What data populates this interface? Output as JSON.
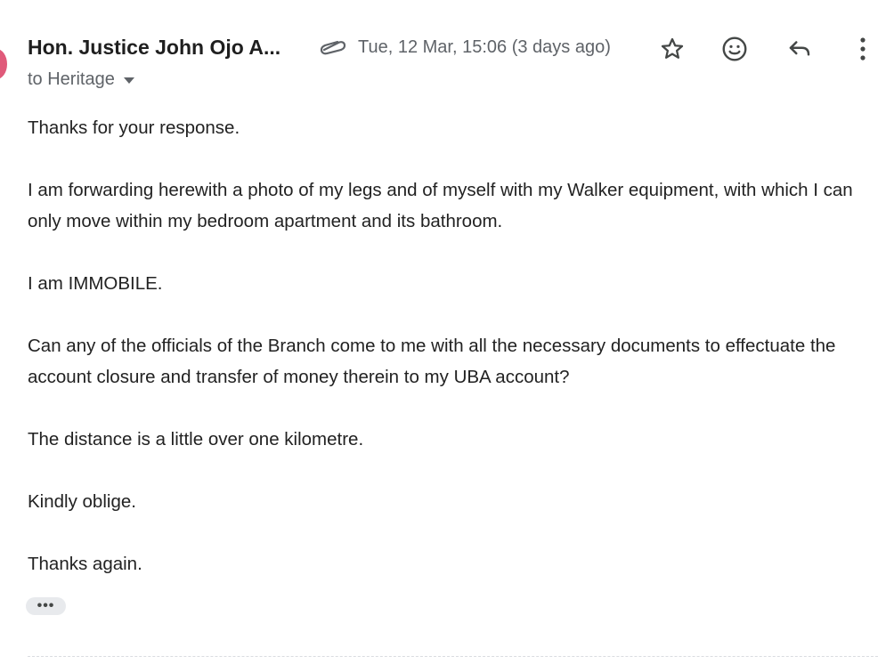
{
  "header": {
    "sender": "Hon. Justice John Ojo A...",
    "timestamp": "Tue, 12 Mar, 15:06 (3 days ago)",
    "attachment_icon": "paperclip-icon",
    "actions": {
      "star_icon": "star-icon",
      "emoji_icon": "emoji-icon",
      "reply_icon": "reply-icon",
      "more_icon": "more-vert-icon"
    }
  },
  "recipient": {
    "label": "to Heritage"
  },
  "message": {
    "paragraphs": [
      "Thanks for your response.",
      "I am forwarding herewith a photo of my legs and of myself with my Walker equipment, with which I can only move within my bedroom apartment and its bathroom.",
      "I am IMMOBILE.",
      "Can any of the officials  of the Branch come to me with all the necessary documents to effectuate the account closure and transfer of money therein to my UBA account?",
      "The distance is a little over one kilometre.",
      "Kindly oblige.",
      "Thanks again."
    ],
    "trimmed_content_label": "•••"
  },
  "colors": {
    "text": "#222222",
    "secondary": "#5f6368",
    "avatar_accent": "#e05a7a",
    "chip_bg": "#e8eaed"
  }
}
